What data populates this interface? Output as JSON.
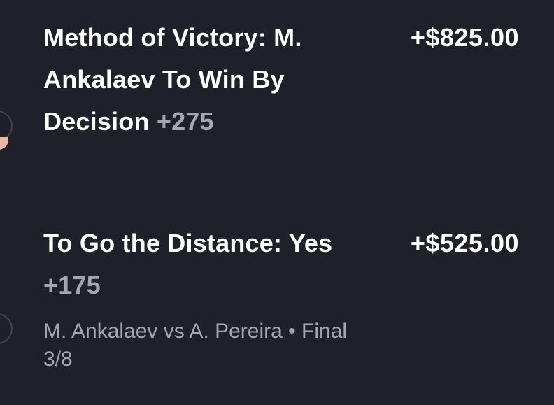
{
  "legs": [
    {
      "title": "Method of Victory: M. Ankalaev To Win By Decision",
      "odds": "+275",
      "payout": "+$825.00"
    },
    {
      "title": "To Go the Distance: Yes",
      "odds": "+175",
      "payout": "+$525.00"
    }
  ],
  "event": {
    "matchup": "M. Ankalaev vs A. Pereira",
    "separator": "•",
    "status": "Final 3/8"
  },
  "colors": {
    "background": "#20202a",
    "primary_text": "#ffffff",
    "secondary_text": "#a6a6b0"
  }
}
